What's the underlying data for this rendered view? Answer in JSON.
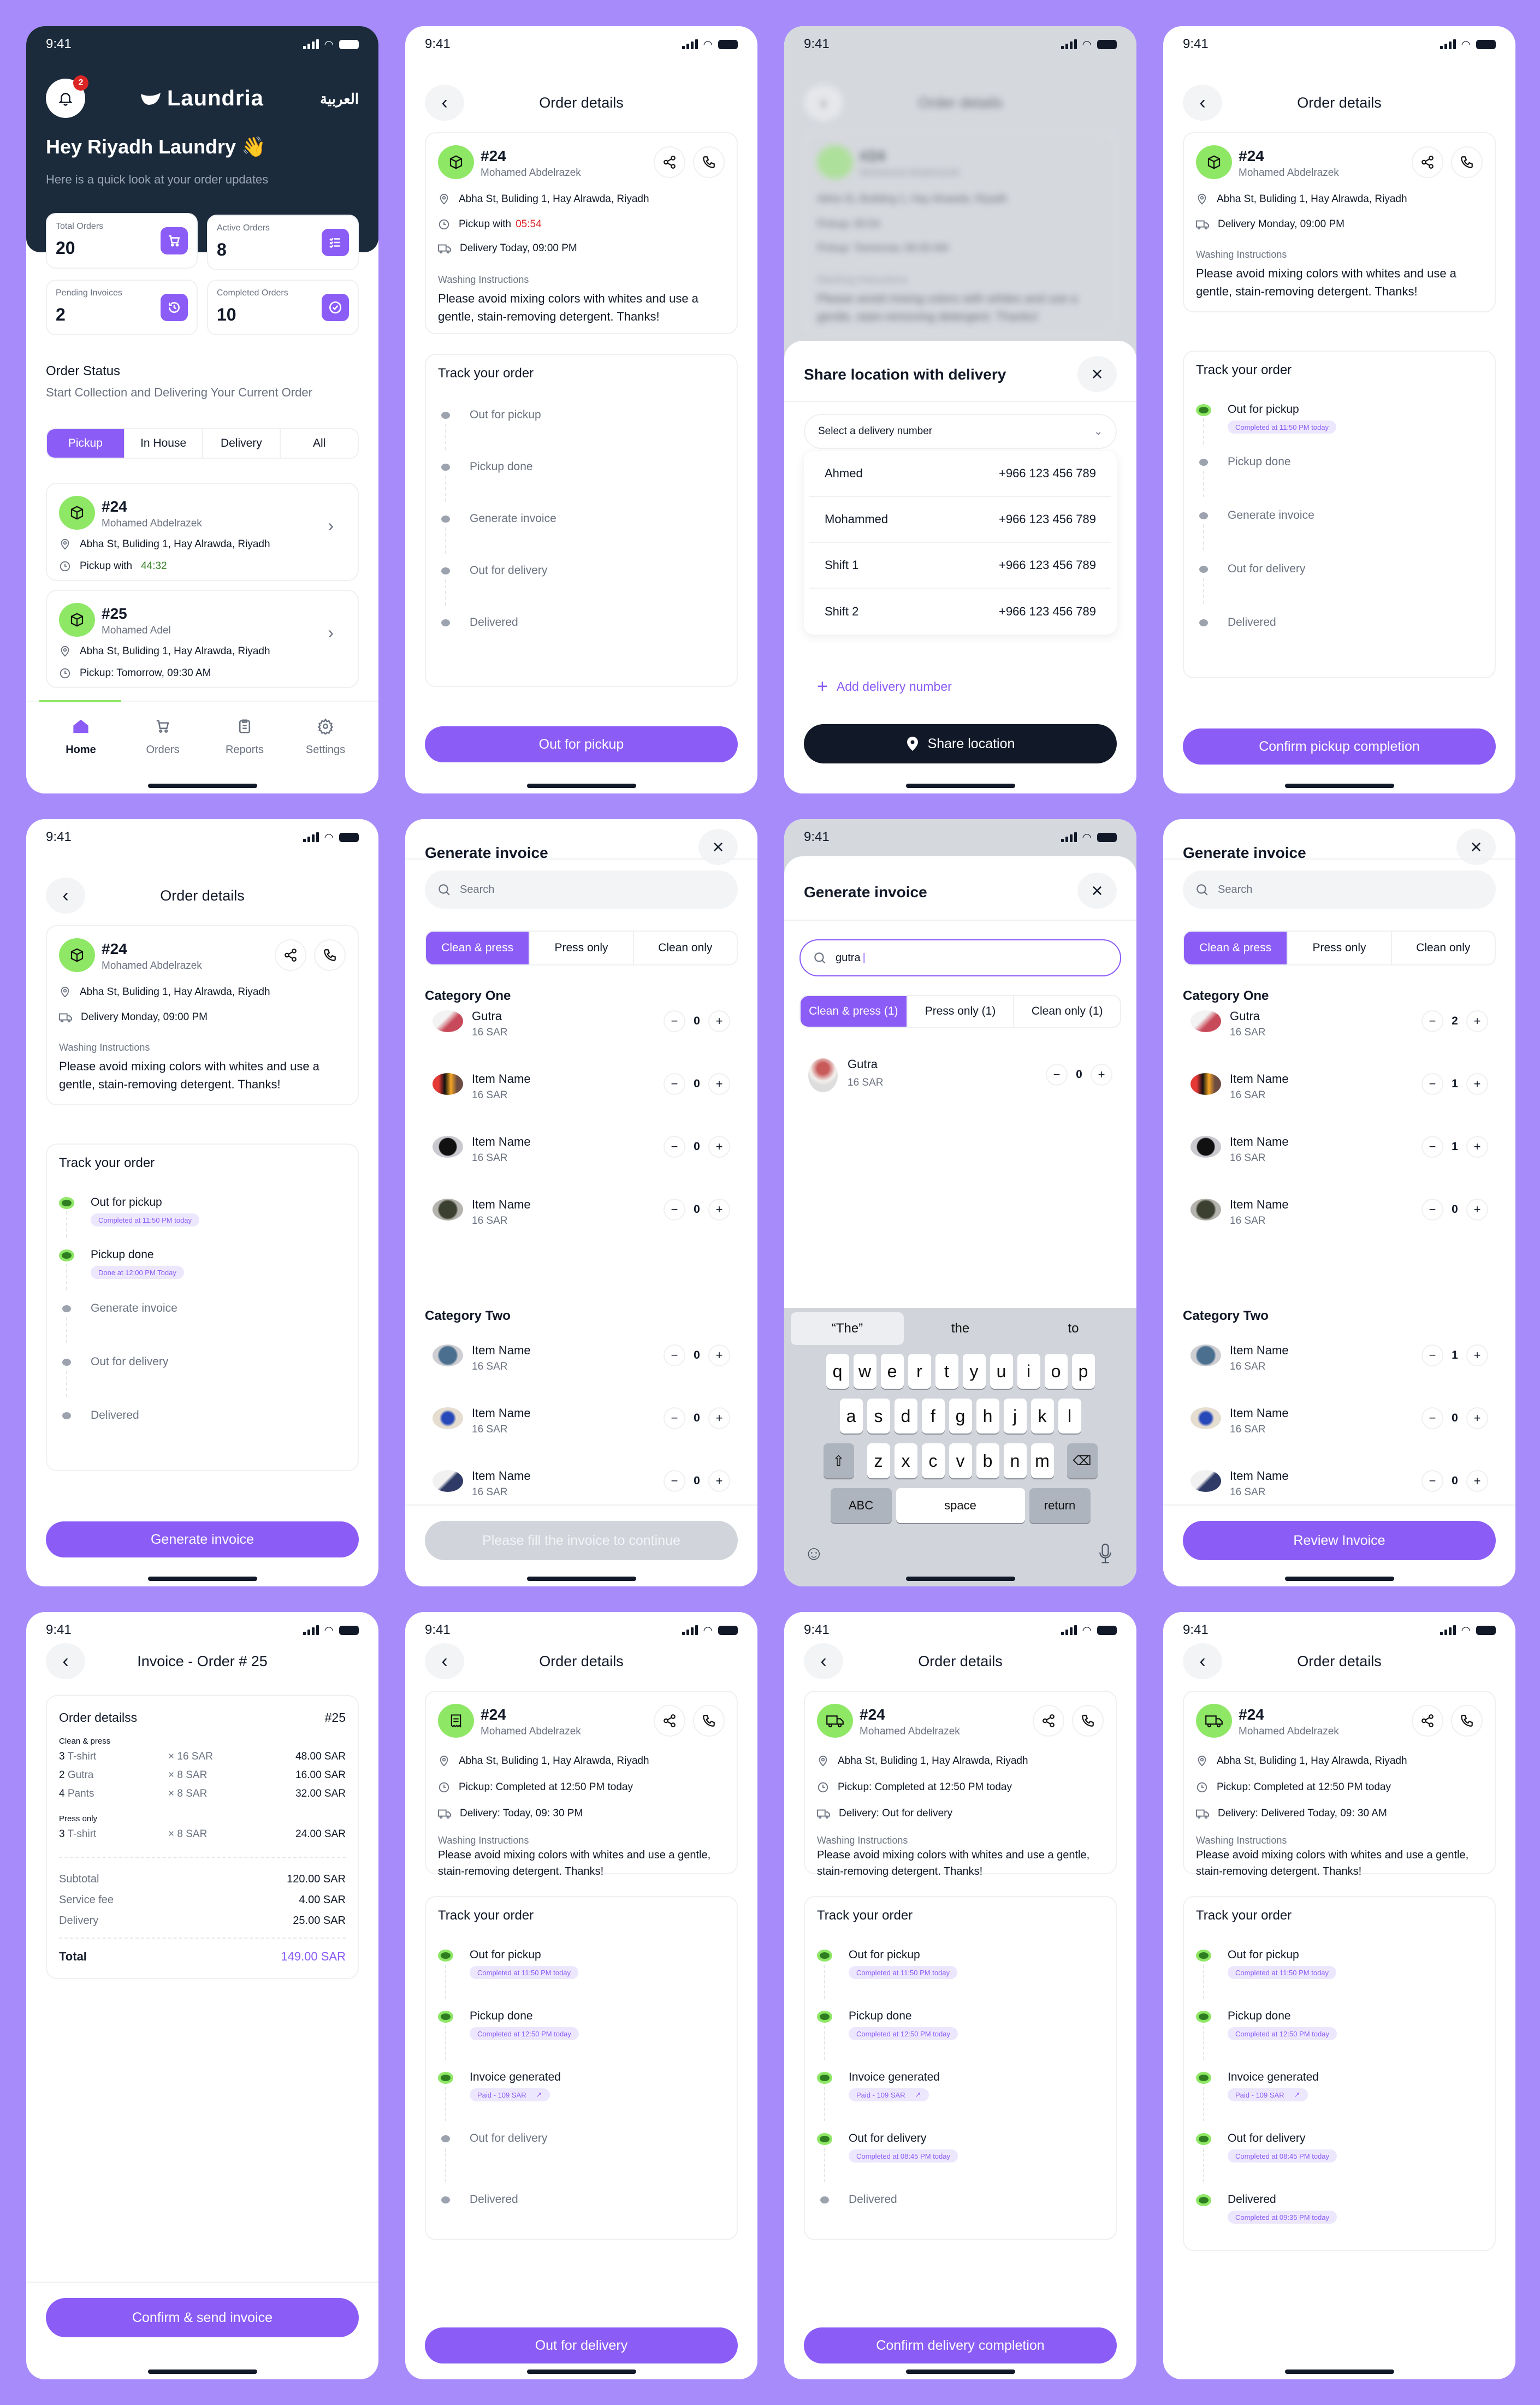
{
  "status_time": "9:41",
  "colors": {
    "accent": "#8b5cf6",
    "dark": "#1b2b3c",
    "green": "#8ee765",
    "green_dark": "#2e7d20",
    "red": "#dc2626",
    "countdown_green": "#2e7d20",
    "background": "#a78bfa"
  },
  "common": {
    "order_number": "#24",
    "customer_name": "Mohamed Abdelrazek",
    "address": "Abha St, Buliding 1, Hay Alrawda, Riyadh",
    "washing_label": "Washing Instructions",
    "washing_text": "Please avoid mixing colors with whites and use a gentle, stain-removing detergent. Thanks!",
    "order_details_title": "Order details",
    "track_title": "Track your order"
  },
  "home": {
    "notification_count": "2",
    "logo_text": "Laundria",
    "language_toggle": "العربية",
    "greeting": "Hey Riyadh Laundry 👋",
    "greeting_sub": "Here is a quick look at your order updates",
    "stats": [
      {
        "label": "Total Orders",
        "value": "20",
        "icon": "cart-icon"
      },
      {
        "label": "Active Orders",
        "value": "8",
        "icon": "checklist-icon"
      },
      {
        "label": "Pending Invoices",
        "value": "2",
        "icon": "history-icon"
      },
      {
        "label": "Completed Orders",
        "value": "10",
        "icon": "check-circle-icon"
      }
    ],
    "section_title": "Order Status",
    "section_sub": "Start Collection and Delivering Your Current Order",
    "filters": [
      "Pickup",
      "In House",
      "Delivery",
      "All"
    ],
    "active_filter": "Pickup",
    "orders": [
      {
        "number": "#24",
        "name": "Mohamed Abdelrazek",
        "address": "Abha St, Buliding 1, Hay Alrawda, Riyadh",
        "time_label": "Pickup with",
        "time_value": "44:32"
      },
      {
        "number": "#25",
        "name": "Mohamed Adel",
        "address": "Abha St, Buliding 1, Hay Alrawda, Riyadh",
        "time_label": "Pickup: Tomorrow, 09:30 AM",
        "time_value": ""
      }
    ],
    "tabs": [
      "Home",
      "Orders",
      "Reports",
      "Settings"
    ],
    "active_tab": "Home"
  },
  "screen2": {
    "pickup_label": "Pickup with",
    "pickup_countdown": "05:54",
    "delivery": "Delivery Today, 09:00 PM",
    "steps": [
      "Out for pickup",
      "Pickup done",
      "Generate invoice",
      "Out for delivery",
      "Delivered"
    ],
    "button": "Out for pickup"
  },
  "share_sheet": {
    "title": "Share location with delivery",
    "select_placeholder": "Select a delivery number",
    "numbers": [
      {
        "name": "Ahmed",
        "phone": "+966 123 456 789"
      },
      {
        "name": "Mohammed",
        "phone": "+966 123 456 789"
      },
      {
        "name": "Shift 1",
        "phone": "+966 123 456 789"
      },
      {
        "name": "Shift 2",
        "phone": "+966 123 456 789"
      }
    ],
    "add_label": "Add delivery number",
    "share_button": "Share location",
    "blurred_pickup": "Pickup: 05:54",
    "blurred_delivery": "Pickup: Tomorrow, 09:30 AM"
  },
  "screen4": {
    "delivery": "Delivery Monday, 09:00 PM",
    "steps": [
      {
        "label": "Out for pickup",
        "done": true,
        "pill": "Completed at 11:50 PM today"
      },
      {
        "label": "Pickup done",
        "done": false,
        "pill": ""
      },
      {
        "label": "Generate invoice",
        "done": false,
        "pill": ""
      },
      {
        "label": "Out for delivery",
        "done": false,
        "pill": ""
      },
      {
        "label": "Delivered",
        "done": false,
        "pill": ""
      }
    ],
    "button": "Confirm pickup completion"
  },
  "screen5": {
    "delivery": "Delivery Monday, 09:00 PM",
    "steps": [
      {
        "label": "Out for pickup",
        "done": true,
        "pill": "Completed at 11:50 PM today"
      },
      {
        "label": "Pickup done",
        "done": true,
        "pill": "Done at 12:00 PM Today"
      },
      {
        "label": "Generate invoice",
        "done": false,
        "pill": ""
      },
      {
        "label": "Out for delivery",
        "done": false,
        "pill": ""
      },
      {
        "label": "Delivered",
        "done": false,
        "pill": ""
      }
    ],
    "button": "Generate invoice"
  },
  "invoice_gen": {
    "title": "Generate invoice",
    "search_placeholder": "Search",
    "tabs": [
      "Clean & press",
      "Press only",
      "Clean only"
    ],
    "category_one": "Category One",
    "category_two": "Category Two",
    "items_one": [
      {
        "name": "Gutra",
        "price": "16 SAR",
        "qty": "0"
      },
      {
        "name": "Item Name",
        "price": "16 SAR",
        "qty": "0"
      },
      {
        "name": "Item Name",
        "price": "16 SAR",
        "qty": "0"
      },
      {
        "name": "Item Name",
        "price": "16 SAR",
        "qty": "0"
      }
    ],
    "items_two": [
      {
        "name": "Item Name",
        "price": "16 SAR",
        "qty": "0"
      },
      {
        "name": "Item Name",
        "price": "16 SAR",
        "qty": "0"
      },
      {
        "name": "Item Name",
        "price": "16 SAR",
        "qty": "0"
      }
    ],
    "button_disabled": "Please fill the invoice to continue"
  },
  "invoice_search": {
    "title": "Generate invoice",
    "query": "gutra",
    "tabs": [
      "Clean & press (1)",
      "Press only (1)",
      "Clean only (1)"
    ],
    "result": {
      "name": "Gutra",
      "price": "16 SAR",
      "qty": "0"
    },
    "suggestions": [
      "“The”",
      "the",
      "to"
    ],
    "keys_row1": [
      "q",
      "w",
      "e",
      "r",
      "t",
      "y",
      "u",
      "i",
      "o",
      "p"
    ],
    "keys_row2": [
      "a",
      "s",
      "d",
      "f",
      "g",
      "h",
      "j",
      "k",
      "l"
    ],
    "keys_row3": [
      "z",
      "x",
      "c",
      "v",
      "b",
      "n",
      "m"
    ],
    "key_abc": "ABC",
    "key_space": "space",
    "key_return": "return"
  },
  "invoice_filled": {
    "items_one": [
      {
        "name": "Gutra",
        "price": "16 SAR",
        "qty": "2"
      },
      {
        "name": "Item Name",
        "price": "16 SAR",
        "qty": "1"
      },
      {
        "name": "Item Name",
        "price": "16 SAR",
        "qty": "1"
      },
      {
        "name": "Item Name",
        "price": "16 SAR",
        "qty": "0"
      }
    ],
    "items_two": [
      {
        "name": "Item Name",
        "price": "16 SAR",
        "qty": "1"
      },
      {
        "name": "Item Name",
        "price": "16 SAR",
        "qty": "0"
      },
      {
        "name": "Item Name",
        "price": "16 SAR",
        "qty": "0"
      }
    ],
    "button": "Review Invoice"
  },
  "invoice_summary": {
    "title": "Invoice - Order # 25",
    "card_title": "Order detailss",
    "card_number": "#25",
    "group1": "Clean & press",
    "group1_rows": [
      {
        "qty": "3",
        "item": "T-shirt",
        "unit": "× 16 SAR",
        "total": "48.00 SAR"
      },
      {
        "qty": "2",
        "item": "Gutra",
        "unit": "× 8 SAR",
        "total": "16.00 SAR"
      },
      {
        "qty": "4",
        "item": "Pants",
        "unit": "× 8 SAR",
        "total": "32.00 SAR"
      }
    ],
    "group2": "Press only",
    "group2_rows": [
      {
        "qty": "3",
        "item": "T-shirt",
        "unit": "× 8 SAR",
        "total": "24.00 SAR"
      }
    ],
    "subtotal_label": "Subtotal",
    "subtotal": "120.00 SAR",
    "fee_label": "Service fee",
    "fee": "4.00 SAR",
    "delivery_label": "Delivery",
    "delivery": "25.00 SAR",
    "total_label": "Total",
    "total": "149.00 SAR",
    "button": "Confirm & send invoice"
  },
  "screen10": {
    "pickup": "Pickup:  Completed at 12:50 PM today",
    "delivery": "Delivery: Today, 09: 30 PM",
    "steps": [
      {
        "label": "Out for pickup",
        "done": true,
        "pill": "Completed at 11:50 PM today"
      },
      {
        "label": "Pickup done",
        "done": true,
        "pill": "Completed at 12:50 PM today"
      },
      {
        "label": "Invoice generated",
        "done": true,
        "pill": "Paid - 109 SAR"
      },
      {
        "label": "Out for delivery",
        "done": false,
        "pill": ""
      },
      {
        "label": "Delivered",
        "done": false,
        "pill": ""
      }
    ],
    "button": "Out for delivery"
  },
  "screen11": {
    "pickup": "Pickup:  Completed at 12:50 PM today",
    "delivery": "Delivery: Out for delivery",
    "steps": [
      {
        "label": "Out for pickup",
        "done": true,
        "pill": "Completed at 11:50 PM today"
      },
      {
        "label": "Pickup done",
        "done": true,
        "pill": "Completed at 12:50 PM today"
      },
      {
        "label": "Invoice generated",
        "done": true,
        "pill": "Paid - 109 SAR"
      },
      {
        "label": "Out for delivery",
        "done": true,
        "pill": "Completed at 08:45 PM today"
      },
      {
        "label": "Delivered",
        "done": false,
        "pill": ""
      }
    ],
    "button": "Confirm delivery completion"
  },
  "screen12": {
    "pickup": "Pickup:  Completed at 12:50 PM today",
    "delivery": "Delivery:  Delivered Today, 09: 30 AM",
    "steps": [
      {
        "label": "Out for pickup",
        "done": true,
        "pill": "Completed at 11:50 PM today"
      },
      {
        "label": "Pickup done",
        "done": true,
        "pill": "Completed at 12:50 PM today"
      },
      {
        "label": "Invoice generated",
        "done": true,
        "pill": "Paid - 109 SAR"
      },
      {
        "label": "Out for delivery",
        "done": true,
        "pill": "Completed at 08:45 PM today"
      },
      {
        "label": "Delivered",
        "done": true,
        "pill": "Completed at 09:35 PM today"
      }
    ]
  }
}
